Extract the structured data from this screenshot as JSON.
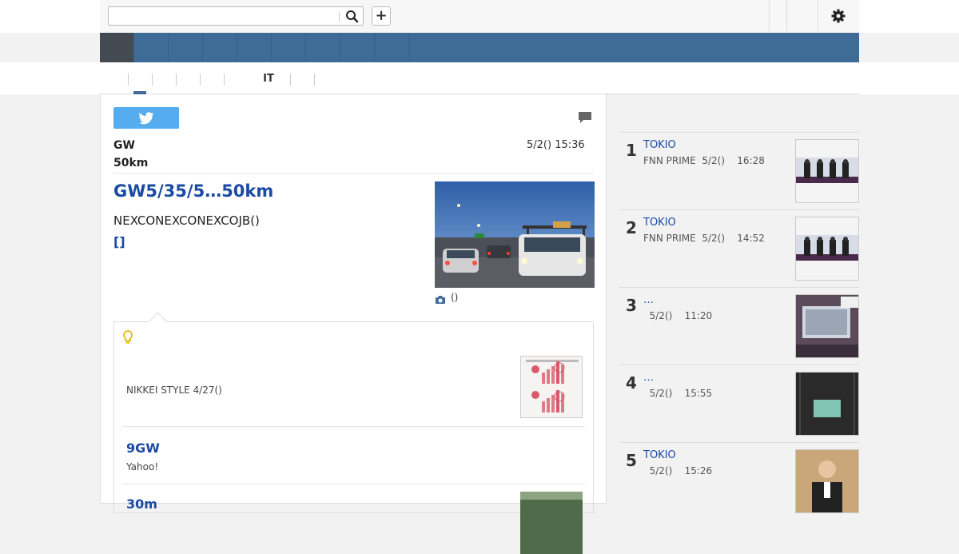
{
  "search": {
    "placeholder": "",
    "value": ""
  },
  "toolbar": {
    "add_label": "+"
  },
  "subnav": {
    "items": [
      "",
      "",
      "",
      "",
      "",
      "IT",
      "",
      ""
    ]
  },
  "article": {
    "category": "GW",
    "category_sub": "50km",
    "date": "5/2() 15:36",
    "headline": "GW5/35/5…50km",
    "lead": "NEXCONEXCONEXCOJB()",
    "more_link": "[]",
    "photo_caption": "()"
  },
  "related": {
    "items": [
      {
        "title": "",
        "source": "NIKKEI STYLE 4/27()"
      },
      {
        "title": "9GW",
        "source": "Yahoo!"
      },
      {
        "title": "30m",
        "source": ""
      }
    ]
  },
  "ranking": [
    {
      "rank": "1",
      "title": "TOKIO",
      "meta": "FNN PRIME  5/2()    16:28"
    },
    {
      "rank": "2",
      "title": "TOKIO",
      "meta": "FNN PRIME  5/2()    14:52"
    },
    {
      "rank": "3",
      "title": "…",
      "meta": "  5/2()    11:20"
    },
    {
      "rank": "4",
      "title": "…",
      "meta": "  5/2()    15:55"
    },
    {
      "rank": "5",
      "title": "TOKIO",
      "meta": "  5/2()    15:26"
    }
  ],
  "colors": {
    "nav": "#3f6b97",
    "link": "#1a4aa3",
    "twitter": "#55acee"
  }
}
